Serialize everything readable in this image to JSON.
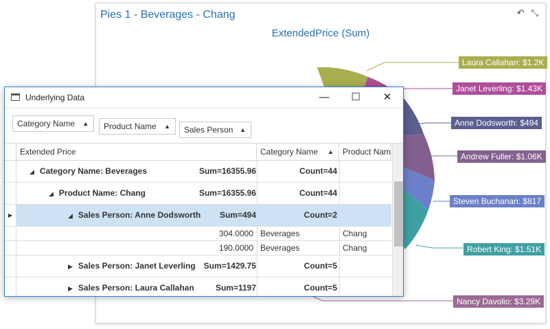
{
  "dashboard": {
    "title": "Pies 1 - Beverages - Chang",
    "undo_icon": "undo-icon",
    "collapse_icon": "collapse-icon",
    "pie_caption": "ExtendedPrice (Sum)",
    "slice_labels": [
      {
        "name": "laura",
        "text": "Laura Callahan: $1.2K",
        "color": "#a9ae4e"
      },
      {
        "name": "janet",
        "text": "Janet Leverling: $1.43K",
        "color": "#b04d99"
      },
      {
        "name": "anne",
        "text": "Anne Dodsworth: $494",
        "color": "#5b5e8f"
      },
      {
        "name": "andrew",
        "text": "Andrew Fuller: $1.06K",
        "color": "#84608f"
      },
      {
        "name": "steven",
        "text": "Steven Buchanan: $817",
        "color": "#6b80c8"
      },
      {
        "name": "robert",
        "text": "Robert King: $1.51K",
        "color": "#3fa0a4"
      },
      {
        "name": "nancy",
        "text": "Nancy Davolio: $3.29K",
        "color": "#9b6a94"
      }
    ]
  },
  "window": {
    "title": "Underlying Data",
    "minimize": "—",
    "maximize": "☐",
    "close": "✕",
    "group_chips": [
      "Category Name",
      "Product Name",
      "Sales Person"
    ],
    "columns": [
      "Extended Price",
      "Category Name",
      "Product Nam"
    ],
    "rows": [
      {
        "label": "Category Name: Beverages",
        "sum": "Sum=16355.96",
        "count": "Count=44"
      },
      {
        "label": "Product Name: Chang",
        "sum": "Sum=16355.96",
        "count": "Count=44"
      },
      {
        "label": "Sales Person: Anne Dodsworth",
        "sum": "Sum=494",
        "count": "Count=2"
      },
      {
        "price": "304.0000",
        "category": "Beverages",
        "product": "Chang"
      },
      {
        "price": "190.0000",
        "category": "Beverages",
        "product": "Chang"
      },
      {
        "label": "Sales Person: Janet Leverling",
        "sum": "Sum=1429.75",
        "count": "Count=5"
      },
      {
        "label": "Sales Person: Laura Callahan",
        "sum": "Sum=1197",
        "count": "Count=5"
      }
    ]
  }
}
